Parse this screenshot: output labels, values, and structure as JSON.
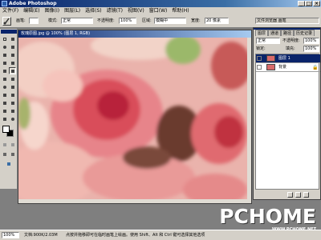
{
  "window": {
    "title": "Adobe Photoshop",
    "min": "_",
    "max": "□",
    "close": "×"
  },
  "menu": [
    "文件(F)",
    "编辑(E)",
    "图像(I)",
    "图层(L)",
    "选择(S)",
    "滤镜(T)",
    "视图(V)",
    "窗口(W)",
    "帮助(H)"
  ],
  "options": {
    "brush_label": "画笔:",
    "mode_label": "模式:",
    "mode_value": "正常",
    "opacity_label": "不透明度:",
    "opacity_value": "100%",
    "area_label": "区域:",
    "area_value": "模糊中",
    "fidelity_label": "宽度:",
    "fidelity_value": "20 像素",
    "palette_well": "文件浏览器 画笔"
  },
  "document": {
    "title": "玫瑰原图.jpg @ 100% (图层 1, RGB)"
  },
  "layers_panel": {
    "tabs": [
      "图层",
      "通道",
      "路径",
      "历史记录"
    ],
    "blend_mode": "正常",
    "opacity_label": "不透明度:",
    "opacity_value": "100%",
    "lock_label": "锁定:",
    "fill_label": "填充:",
    "fill_value": "100%",
    "layers": [
      {
        "name": "图层 1",
        "selected": true
      },
      {
        "name": "背景",
        "selected": false
      }
    ]
  },
  "status": {
    "zoom": "100%",
    "doc_size": "文档:900K/2.03M",
    "hint": "点按并拖移即可在临时画笔上绘画。使用 Shift、Alt 和 Ctrl 键可选择其他选项"
  },
  "watermark": {
    "brand": "PCHOME",
    "url": "WWW.PCHOME.NET"
  },
  "colors": {
    "selected_layer": "#0a246a",
    "title_gradient_start": "#0a246a"
  }
}
